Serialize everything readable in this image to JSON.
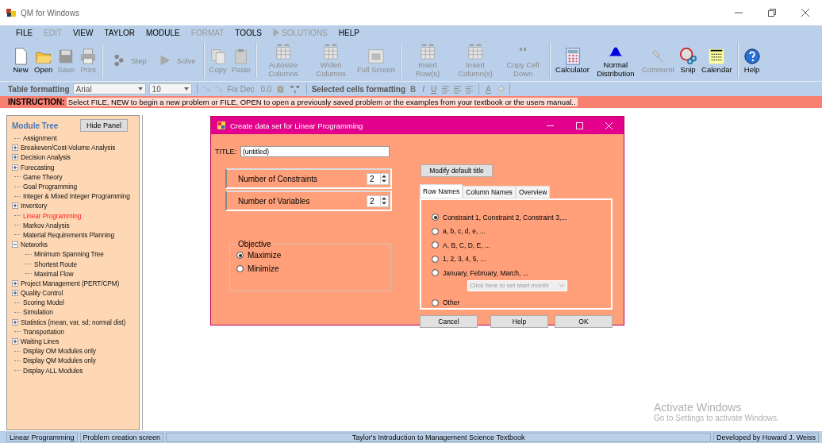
{
  "app": {
    "title": "QM for Windows"
  },
  "menu": [
    {
      "label": "FILE",
      "disabled": false,
      "kind": "text"
    },
    {
      "label": "EDIT",
      "disabled": true,
      "kind": "text"
    },
    {
      "label": "VIEW",
      "disabled": false,
      "kind": "text"
    },
    {
      "label": "TAYLOR",
      "disabled": false,
      "kind": "text"
    },
    {
      "label": "MODULE",
      "disabled": false,
      "kind": "text"
    },
    {
      "label": "FORMAT",
      "disabled": true,
      "kind": "text"
    },
    {
      "label": "TOOLS",
      "disabled": false,
      "kind": "text"
    },
    {
      "label": "SOLUTIONS",
      "disabled": true,
      "kind": "play"
    },
    {
      "label": "HELP",
      "disabled": false,
      "kind": "text"
    }
  ],
  "toolbar": [
    [
      {
        "label": "New",
        "kind": "new",
        "disabled": false
      },
      {
        "label": "Open",
        "kind": "open",
        "disabled": false
      },
      {
        "label": "Save",
        "kind": "save",
        "disabled": true
      },
      {
        "label": "Print",
        "kind": "print",
        "disabled": true
      }
    ],
    [
      {
        "label": "Step",
        "kind": "step",
        "disabled": true
      },
      {
        "label": "Solve",
        "kind": "solve",
        "disabled": true
      }
    ],
    [
      {
        "label": "Copy",
        "kind": "copy",
        "disabled": true
      },
      {
        "label": "Paste",
        "kind": "paste",
        "disabled": true
      }
    ],
    [
      {
        "label": "Autosize Columns",
        "kind": "grid",
        "disabled": true
      },
      {
        "label": "Widen Columns",
        "kind": "grid",
        "disabled": true
      },
      {
        "label": "Full Screen",
        "kind": "screen",
        "disabled": true
      }
    ],
    [
      {
        "label": "Insert Row(s)",
        "kind": "grid",
        "disabled": true
      },
      {
        "label": "Insert Column(s)",
        "kind": "grid",
        "disabled": true
      },
      {
        "label": "Copy Cell Down",
        "kind": "quote",
        "disabled": true
      }
    ],
    [
      {
        "label": "Calculator",
        "kind": "calculator",
        "disabled": false
      },
      {
        "label": "Normal Distribution",
        "kind": "bell",
        "disabled": false
      },
      {
        "label": "Comment",
        "kind": "pin",
        "disabled": true
      },
      {
        "label": "Snip",
        "kind": "snip",
        "disabled": false
      },
      {
        "label": "Calendar",
        "kind": "calendar",
        "disabled": false
      }
    ],
    [
      {
        "label": "Help",
        "kind": "help",
        "disabled": false
      }
    ]
  ],
  "format_bar": {
    "label": "Table formatting",
    "font": "Arial",
    "size": "10",
    "fix_dec": "Fix Dec",
    "decimal": "0.0",
    "comma": "\",\"",
    "selected_label": "Selected cells formatting",
    "bold": "B",
    "italic": "I",
    "underline": "U",
    "font_color": "A"
  },
  "instruction": {
    "label": "INSTRUCTION:",
    "text": "Select FILE, NEW to begin a new problem or FILE, OPEN to open a previously saved problem or the examples from your textbook or the users manual.."
  },
  "module_tree": {
    "title": "Module Tree",
    "hide_button": "Hide Panel",
    "items": [
      {
        "label": "Assignment",
        "kind": "leaf",
        "selected": false
      },
      {
        "label": "Breakeven/Cost-Volume Analysis",
        "kind": "group",
        "expanded": false,
        "selected": false
      },
      {
        "label": "Decision Analysis",
        "kind": "group",
        "expanded": false,
        "selected": false
      },
      {
        "label": "Forecasting",
        "kind": "group",
        "expanded": false,
        "selected": false
      },
      {
        "label": "Game Theory",
        "kind": "leaf",
        "selected": false
      },
      {
        "label": "Goal Programming",
        "kind": "leaf",
        "selected": false
      },
      {
        "label": "Integer & Mixed Integer Programming",
        "kind": "leaf",
        "selected": false
      },
      {
        "label": "Inventory",
        "kind": "group",
        "expanded": false,
        "selected": false
      },
      {
        "label": "Linear Programming",
        "kind": "leaf",
        "selected": true
      },
      {
        "label": "Markov Analysis",
        "kind": "leaf",
        "selected": false
      },
      {
        "label": "Material Requirements Planning",
        "kind": "leaf",
        "selected": false
      },
      {
        "label": "Networks",
        "kind": "group",
        "expanded": true,
        "selected": false,
        "children": [
          {
            "label": "Minimum Spanning Tree",
            "selected": false
          },
          {
            "label": "Shortest Route",
            "selected": false
          },
          {
            "label": "Maximal Flow",
            "selected": false
          }
        ]
      },
      {
        "label": "Project Management (PERT/CPM)",
        "kind": "group",
        "expanded": false,
        "selected": false
      },
      {
        "label": "Quality Control",
        "kind": "group",
        "expanded": false,
        "selected": false
      },
      {
        "label": "Scoring Model",
        "kind": "leaf",
        "selected": false
      },
      {
        "label": "Simulation",
        "kind": "leaf",
        "selected": false
      },
      {
        "label": "Statistics (mean, var, sd; normal dist)",
        "kind": "group",
        "expanded": false,
        "selected": false
      },
      {
        "label": "Transportation",
        "kind": "leaf",
        "selected": false
      },
      {
        "label": "Waiting Lines",
        "kind": "group",
        "expanded": false,
        "selected": false
      },
      {
        "label": "Display OM Modules only",
        "kind": "leaf",
        "selected": false
      },
      {
        "label": "Display QM Modules only",
        "kind": "leaf",
        "selected": false
      },
      {
        "label": "Display ALL Modules",
        "kind": "leaf",
        "selected": false
      }
    ]
  },
  "dialog": {
    "title": "Create data set for Linear Programming",
    "title_label": "TITLE:",
    "title_value": "(untitled)",
    "modify_button": "Modify default title",
    "spinners": [
      {
        "label": "Number of Constraints",
        "value": "2"
      },
      {
        "label": "Number of Variables",
        "value": "2"
      }
    ],
    "objective": {
      "label": "Objective",
      "options": [
        {
          "label": "Maximize",
          "selected": true
        },
        {
          "label": "Minimize",
          "selected": false
        }
      ]
    },
    "tabs": [
      {
        "label": "Row Names",
        "selected": true
      },
      {
        "label": "Column Names",
        "selected": false
      },
      {
        "label": "Overview",
        "selected": false
      }
    ],
    "row_names": [
      {
        "label": "Constraint 1, Constraint 2, Constraint 3,...",
        "selected": true,
        "kind": "plain"
      },
      {
        "label": "a, b, c, d, e, ...",
        "selected": false,
        "kind": "plain"
      },
      {
        "label": "A, B, C, D, E, ...",
        "selected": false,
        "kind": "plain"
      },
      {
        "label": "1, 2, 3, 4, 5, ...",
        "selected": false,
        "kind": "plain"
      },
      {
        "label": "January, February, March, ...",
        "selected": false,
        "kind": "month",
        "placeholder": "Click here to set start month"
      },
      {
        "label": "Other",
        "selected": false,
        "kind": "other"
      }
    ],
    "buttons": [
      "Cancel",
      "Help",
      "OK"
    ]
  },
  "watermark": {
    "title": "Activate Windows",
    "text": "Go to Settings to activate Windows."
  },
  "status_bar": [
    "Linear Programming",
    "Problem creation screen",
    "Taylor's Introduction to Management Science Textbook",
    "Developed by Howard J. Weiss"
  ]
}
